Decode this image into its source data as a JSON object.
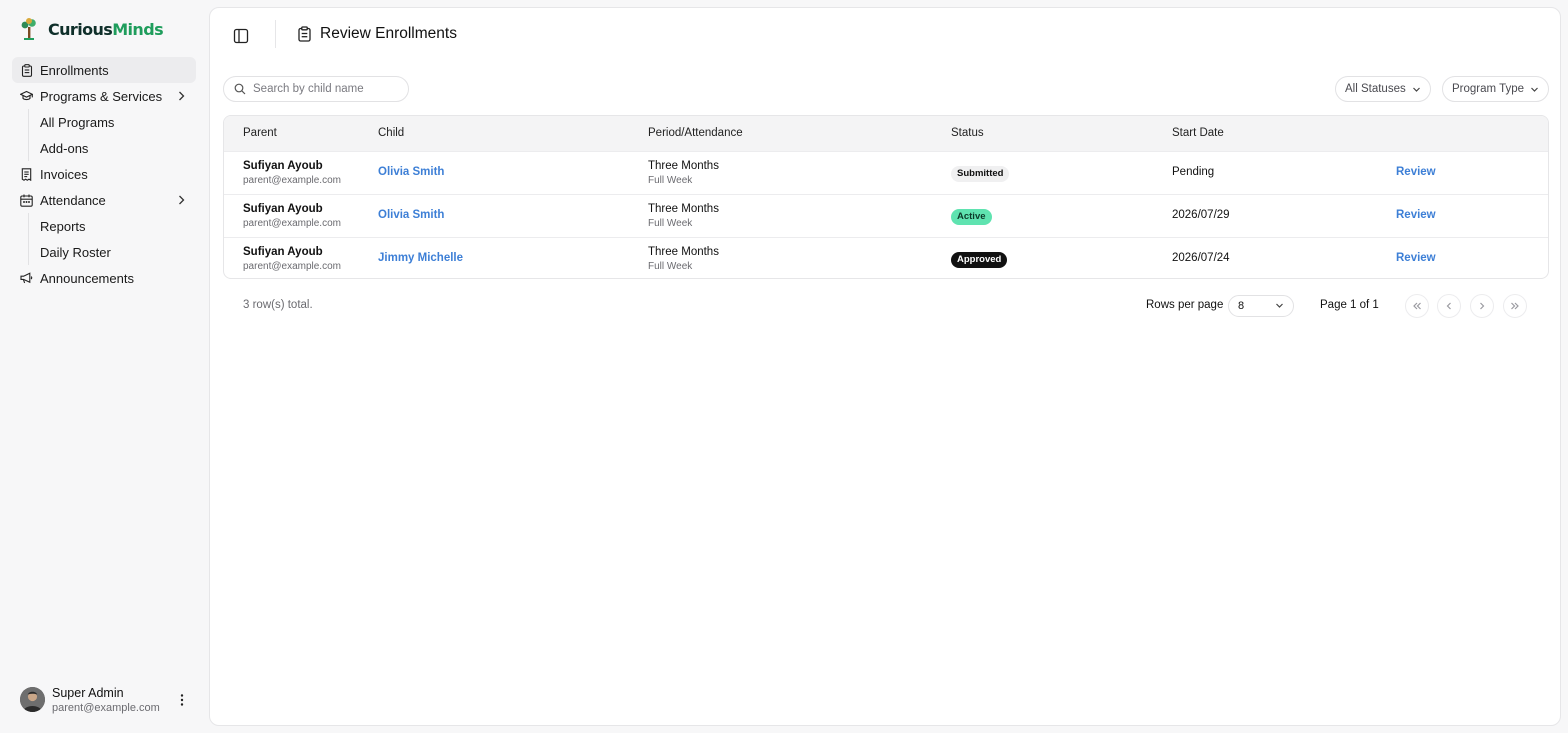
{
  "brand": {
    "part1": "Curious",
    "part2": "Minds"
  },
  "sidebar": {
    "items": [
      {
        "label": "Enrollments"
      },
      {
        "label": "Programs & Services"
      },
      {
        "label": "All Programs"
      },
      {
        "label": "Add-ons"
      },
      {
        "label": "Invoices"
      },
      {
        "label": "Attendance"
      },
      {
        "label": "Reports"
      },
      {
        "label": "Daily Roster"
      },
      {
        "label": "Announcements"
      }
    ]
  },
  "user": {
    "name": "Super Admin",
    "email": "parent@example.com"
  },
  "header": {
    "title": "Review Enrollments"
  },
  "search": {
    "placeholder": "Search by child name"
  },
  "filters": {
    "status": "All Statuses",
    "program": "Program Type"
  },
  "table": {
    "columns": [
      "Parent",
      "Child",
      "Period/Attendance",
      "Status",
      "Start Date"
    ],
    "rows": [
      {
        "parent": "Sufiyan Ayoub",
        "parent_email": "parent@example.com",
        "child": "Olivia Smith",
        "period": "Three Months",
        "attendance": "Full Week",
        "status": "Submitted",
        "start": "Pending",
        "action": "Review"
      },
      {
        "parent": "Sufiyan Ayoub",
        "parent_email": "parent@example.com",
        "child": "Olivia Smith",
        "period": "Three Months",
        "attendance": "Full Week",
        "status": "Active",
        "start": "2026/07/29",
        "action": "Review"
      },
      {
        "parent": "Sufiyan Ayoub",
        "parent_email": "parent@example.com",
        "child": "Jimmy Michelle",
        "period": "Three Months",
        "attendance": "Full Week",
        "status": "Approved",
        "start": "2026/07/24",
        "action": "Review"
      }
    ]
  },
  "footer": {
    "total": "3 row(s) total.",
    "rows_per_page_label": "Rows per page",
    "rows_per_page": "8",
    "page_info": "Page 1 of 1"
  },
  "colors": {
    "accent_link": "#3d7fd6",
    "brand_green": "#1f9d5c",
    "status_submitted_bg": "#f0f0f1",
    "status_active_bg": "#5fe3b0",
    "status_approved_bg": "#111111"
  }
}
